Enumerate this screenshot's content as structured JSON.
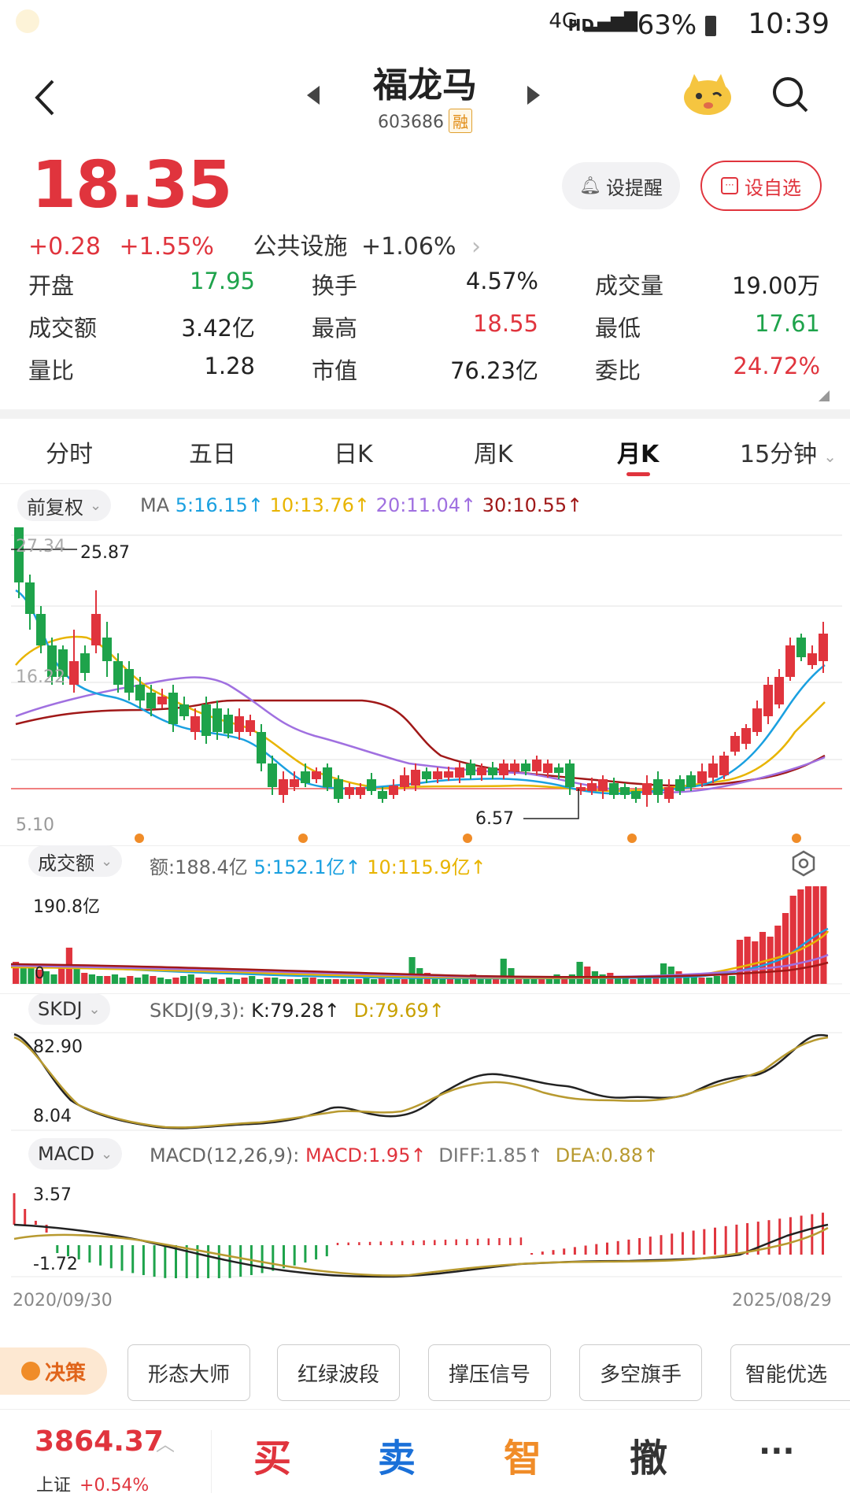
{
  "status_bar": {
    "hd": "HD",
    "network": "4G",
    "battery": "63%",
    "time": "10:39"
  },
  "header": {
    "title": "福龙马",
    "code": "603686",
    "badge": "融"
  },
  "quote": {
    "price": "18.35",
    "change": "+0.28",
    "change_pct": "+1.55%",
    "sector_name": "公共设施",
    "sector_pct": "+1.06%",
    "remind_label": "设提醒",
    "watch_label": "设自选",
    "stats": [
      {
        "label": "开盘",
        "value": "17.95",
        "color": "green"
      },
      {
        "label": "换手",
        "value": "4.57%",
        "color": "black"
      },
      {
        "label": "成交量",
        "value": "19.00万",
        "color": "black"
      },
      {
        "label": "成交额",
        "value": "3.42亿",
        "color": "black"
      },
      {
        "label": "最高",
        "value": "18.55",
        "color": "red"
      },
      {
        "label": "最低",
        "value": "17.61",
        "color": "green"
      },
      {
        "label": "量比",
        "value": "1.28",
        "color": "black"
      },
      {
        "label": "市值",
        "value": "76.23亿",
        "color": "black"
      },
      {
        "label": "委比",
        "value": "24.72%",
        "color": "red"
      }
    ]
  },
  "tabs": [
    "分时",
    "五日",
    "日K",
    "周K",
    "月K",
    "15分钟"
  ],
  "active_tab": "月K",
  "kline": {
    "adjust": "前复权",
    "ma_label": "MA",
    "ma": [
      {
        "text": "5:16.15↑",
        "color": "#1aa0e0"
      },
      {
        "text": "10:13.76↑",
        "color": "#e8b400"
      },
      {
        "text": "20:11.04↑",
        "color": "#a070e0"
      },
      {
        "text": "30:10.55↑",
        "color": "#a01818"
      }
    ],
    "axis_top": "27.34",
    "axis_mid": "16.22",
    "axis_bottom": "5.10",
    "high_label": "25.87",
    "low_label": "6.57"
  },
  "volume": {
    "selector": "成交额",
    "summary": "额:188.4亿",
    "ma5": "5:152.1亿↑",
    "ma10": "10:115.9亿↑",
    "axis_top": "190.8亿",
    "axis_zero": "0"
  },
  "skdj": {
    "selector": "SKDJ",
    "params": "SKDJ(9,3):",
    "k": "K:79.28↑",
    "d": "D:79.69↑",
    "axis_top": "82.90",
    "axis_bottom": "8.04"
  },
  "macd": {
    "selector": "MACD",
    "params": "MACD(12,26,9):",
    "macd": "MACD:1.95↑",
    "diff": "DIFF:1.85↑",
    "dea": "DEA:0.88↑",
    "axis_top": "3.57",
    "axis_bottom": "-1.72"
  },
  "date_range": {
    "start": "2020/09/30",
    "end": "2025/08/29"
  },
  "strategy": {
    "tag": "决策",
    "buttons": [
      "形态大师",
      "红绿波段",
      "撑压信号",
      "多空旗手",
      "智能优选"
    ]
  },
  "bottom": {
    "index_value": "3864.37",
    "index_name": "上证",
    "index_pct": "+0.54%",
    "actions": [
      "买",
      "卖",
      "智",
      "撤",
      "···"
    ]
  },
  "colors": {
    "up": "#e0343d",
    "down": "#1ea34b",
    "ma5": "#1aa0e0",
    "ma10": "#e8b400",
    "ma20": "#a070e0",
    "ma30": "#a01818"
  }
}
